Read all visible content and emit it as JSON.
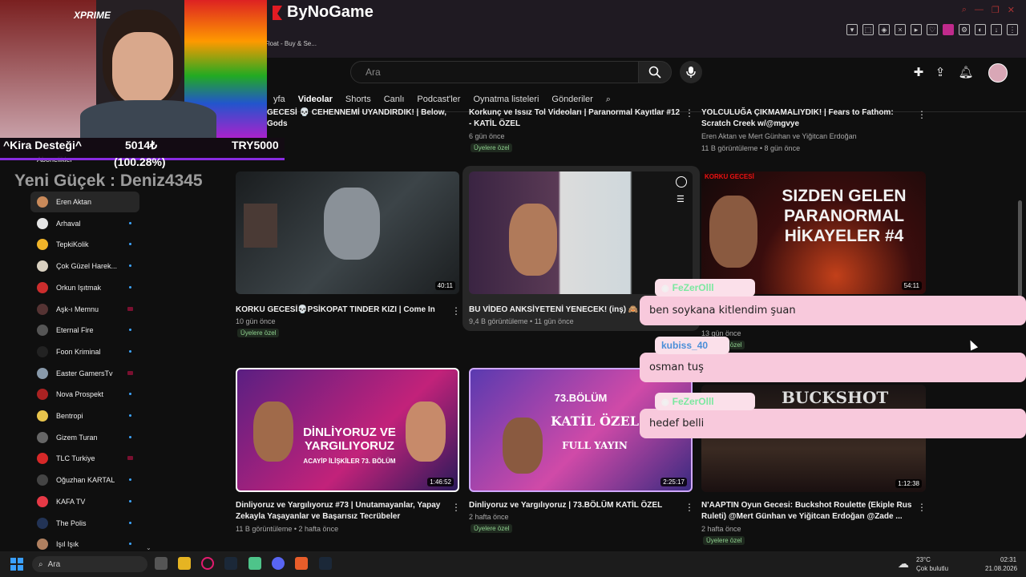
{
  "browser": {
    "tab_title": "Float - Buy & Se...",
    "logo_text": "ByNoGame",
    "accent": "#e31b23"
  },
  "youtube": {
    "search_placeholder": "Ara",
    "tabs": [
      "yfa",
      "Videolar",
      "Shorts",
      "Canlı",
      "Podcast'ler",
      "Oynatma listeleri",
      "Gönderiler"
    ]
  },
  "sidebar": {
    "top_label": "Abonelikler",
    "items": [
      {
        "label": "Eren Aktan",
        "color": "#c98a5a"
      },
      {
        "label": "Arhaval",
        "color": "#e5e5e5"
      },
      {
        "label": "TepkiKolik",
        "color": "#f0b429"
      },
      {
        "label": "Çok Güzel Harek...",
        "color": "#d9d0c0"
      },
      {
        "label": "Orkun Işıtmak",
        "color": "#cc2d2d"
      },
      {
        "label": "Aşk-ı Memnu",
        "color": "#553333"
      },
      {
        "label": "Eternal Fire",
        "color": "#555555"
      },
      {
        "label": "Foon Kriminal",
        "color": "#222222"
      },
      {
        "label": "Easter GamersTv",
        "color": "#8899aa"
      },
      {
        "label": "Nova Prospekt",
        "color": "#aa2222"
      },
      {
        "label": "Bentropi",
        "color": "#e8c44c"
      },
      {
        "label": "Gizem Turan",
        "color": "#666666"
      },
      {
        "label": "TLC Turkiye",
        "color": "#d62828"
      },
      {
        "label": "Oğuzhan KARTAL",
        "color": "#444444"
      },
      {
        "label": "KAFA TV",
        "color": "#e63946"
      },
      {
        "label": "The Polis",
        "color": "#223355"
      },
      {
        "label": "Işıl Işık",
        "color": "#b08060"
      }
    ]
  },
  "videos_top": [
    {
      "title": "GECESİ 💀 CEHENNEMİ UYANDIRDIK! | Below,",
      "title2": "Gods"
    },
    {
      "title": "Korkunç ve Issız Tol Videoları | Paranormal Kayıtlar #12",
      "title2": "- KATİL ÖZEL",
      "meta": "6 gün önce",
      "badge": "Üyelere özel"
    },
    {
      "title": "YOLCULUĞA ÇIKMAMALIYDIK! | Fears to Fathom:",
      "title2": "Scratch Creek w/@mgvye",
      "meta": "Eren Aktan ve Mert Günhan ve Yiğitcan Erdoğan",
      "meta2": "11 B görüntüleme • 8 gün önce"
    }
  ],
  "videos_row2": [
    {
      "title": "KORKU GECESİ💀PSİKOPAT TINDER KIZI | Come In",
      "duration": "40:11",
      "meta": "10 gün önce",
      "badge": "Üyelere özel"
    },
    {
      "title": "BU VİDEO ANKSİYETENİ YENECEK! (inş) 🙈",
      "meta": "9,4 B görüntüleme • 11 gün önce"
    },
    {
      "duration": "54:11",
      "meta": "13 gün önce",
      "badge": "Üyelere özel",
      "thumb_text": "SIZDEN GELEN PARANORMAL HİKAYELER #4",
      "thumb_small": "KORKU GECESİ"
    }
  ],
  "videos_row3": [
    {
      "title": "Dinliyoruz ve Yargılıyoruz #73 | Unutamayanlar, Yapay",
      "title2": "Zekayla Yaşayanlar ve Başarısız Tecrübeler",
      "duration": "1:46:52",
      "meta": "11 B görüntüleme • 2 hafta önce",
      "thumb_text": "DİNLİYORUZ VE YARGILIYORUZ",
      "thumb_sub": "ACAYİP İLİŞKİLER 73. BÖLÜM"
    },
    {
      "title": "Dinliyoruz ve Yargılıyoruz | 73.BÖLÜM KATİL ÖZEL",
      "duration": "2:25:17",
      "meta": "2 hafta önce",
      "badge": "Üyelere özel",
      "thumb_text": "KATİL ÖZEL",
      "thumb_sub": "FULL YAYIN",
      "thumb_top": "73.BÖLÜM"
    },
    {
      "title": "N'AAPTIN Oyun Gecesi: Buckshot Roulette (Ekiple Rus",
      "title2": "Ruleti) @Mert Günhan ve Yiğitcan Erdoğan @Zade ...",
      "duration": "1:12:38",
      "meta": "2 hafta önce",
      "badge": "Üyelere özel",
      "thumb_text": "BUCKSHOT"
    }
  ],
  "overlay": {
    "donation_label": "^Kira Desteği^",
    "donation_amount": "5014₺",
    "donation_goal": "TRY5000",
    "donation_percent": "(100.28%)",
    "new_follower": "Yeni Güçek : Deniz4345",
    "cam_brand": "XPRIME"
  },
  "chat": [
    {
      "user": "FeZerOlll",
      "user_color": "#7be8a0",
      "message": "ben soykana kitlendim şuan"
    },
    {
      "user": "kubiss_40",
      "user_color": "#4a8fd8",
      "message": "osman tuş"
    },
    {
      "user": "FeZerOlll",
      "user_color": "#7be8a0",
      "message": "hedef belli"
    }
  ],
  "taskbar": {
    "search_label": "Ara",
    "weather_temp": "23°C",
    "weather_desc": "Çok bulutlu",
    "time": "02:31",
    "date": "21.08.2026"
  }
}
